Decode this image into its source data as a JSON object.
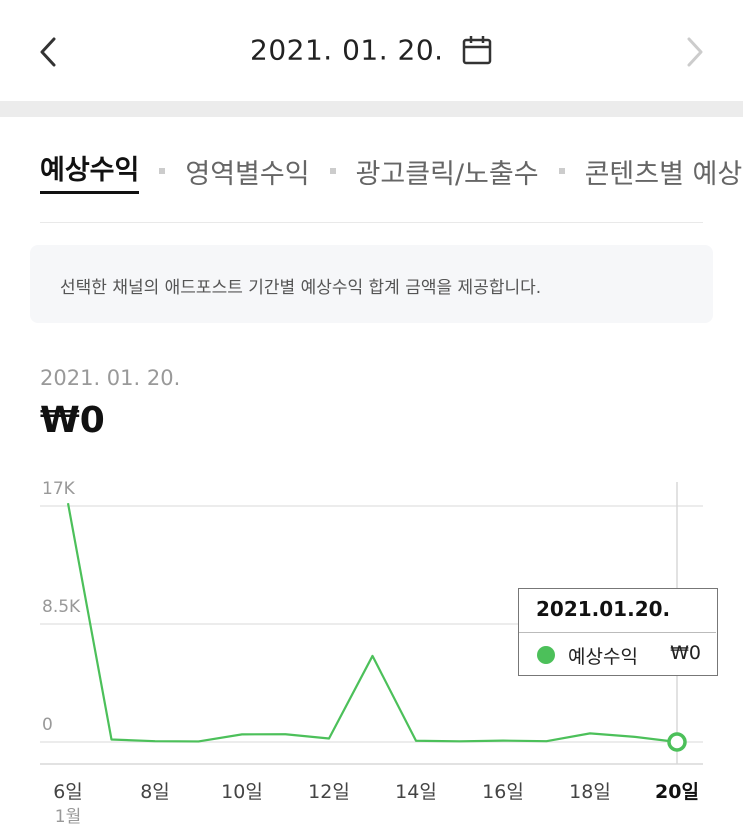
{
  "header": {
    "date": "2021. 01. 20.",
    "prev_icon": "chevron-left-icon",
    "next_icon": "chevron-right-icon",
    "calendar_icon": "calendar-icon"
  },
  "tabs": [
    {
      "label": "예상수익",
      "active": true
    },
    {
      "label": "영역별수익",
      "active": false
    },
    {
      "label": "광고클릭/노출수",
      "active": false
    },
    {
      "label": "콘텐츠별 예상",
      "active": false
    }
  ],
  "notice": "선택한 채널의 애드포스트 기간별 예상수익 합계 금액을 제공합니다.",
  "summary": {
    "date": "2021. 01. 20.",
    "amount": "₩0"
  },
  "tooltip": {
    "date": "2021.01.20.",
    "series_name": "예상수익",
    "value": "₩0"
  },
  "colors": {
    "line": "#4cc05a",
    "grid": "#e6e6e6",
    "tick_text": "#999999"
  },
  "chart_data": {
    "type": "line",
    "x": [
      "6일",
      "7일",
      "8일",
      "9일",
      "10일",
      "11일",
      "12일",
      "13일",
      "14일",
      "15일",
      "16일",
      "17일",
      "18일",
      "19일",
      "20일"
    ],
    "x_tick_labels": [
      "6일",
      "8일",
      "10일",
      "12일",
      "14일",
      "16일",
      "18일",
      "20일"
    ],
    "x_sublabel": "1월",
    "series": [
      {
        "name": "예상수익",
        "values": [
          17200,
          180,
          60,
          40,
          550,
          560,
          250,
          6200,
          90,
          50,
          100,
          60,
          620,
          380,
          0
        ]
      }
    ],
    "y_ticks": [
      0,
      8500,
      17000
    ],
    "y_tick_labels": [
      "0",
      "8.5K",
      "17K"
    ],
    "ylim": [
      0,
      17000
    ],
    "grid": true,
    "selected_index": 14
  }
}
